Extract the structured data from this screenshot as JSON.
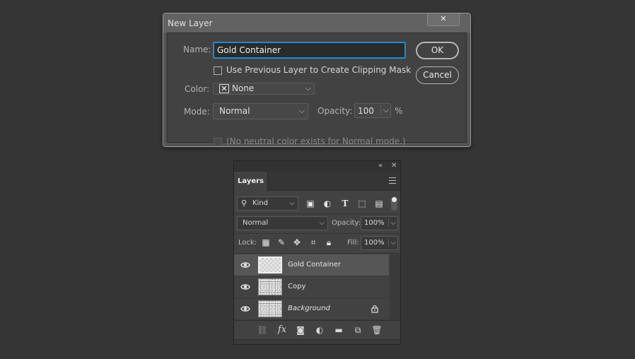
{
  "dialog": {
    "title": "New Layer",
    "close_label": "✕",
    "name_label": "Name:",
    "name_value": "Gold Container",
    "clipping_label": "Use Previous Layer to Create Clipping Mask",
    "clipping_checked": false,
    "color_label": "Color:",
    "color_value": "None",
    "mode_label": "Mode:",
    "mode_value": "Normal",
    "opacity_label": "Opacity:",
    "opacity_value": "100",
    "opacity_unit": "%",
    "neutral_label": "(No neutral color exists for Normal mode.)",
    "ok_label": "OK",
    "cancel_label": "Cancel",
    "accent_color": "#1f8ad8"
  },
  "layers_panel": {
    "tab_label": "Layers",
    "collapse_icon": "«",
    "close_icon": "✕",
    "filter_kind": "Kind",
    "filter_icons": [
      "image-filter-icon",
      "adjustment-filter-icon",
      "type-filter-icon",
      "shape-filter-icon",
      "smart-object-filter-icon"
    ],
    "blend_mode": "Normal",
    "opacity_label": "Opacity:",
    "opacity_value": "100%",
    "lock_label": "Lock:",
    "fill_label": "Fill:",
    "fill_value": "100%",
    "layers": [
      {
        "name": "Gold Container",
        "selected": true,
        "visible": true,
        "locked": false,
        "italic": false
      },
      {
        "name": "Copy",
        "selected": false,
        "visible": true,
        "locked": false,
        "italic": false
      },
      {
        "name": "Background",
        "selected": false,
        "visible": true,
        "locked": true,
        "italic": true
      }
    ],
    "bottom_icons": [
      "link-icon",
      "fx-icon",
      "mask-icon",
      "adjustment-icon",
      "folder-icon",
      "new-layer-icon",
      "trash-icon"
    ],
    "fx_label": "fx"
  }
}
